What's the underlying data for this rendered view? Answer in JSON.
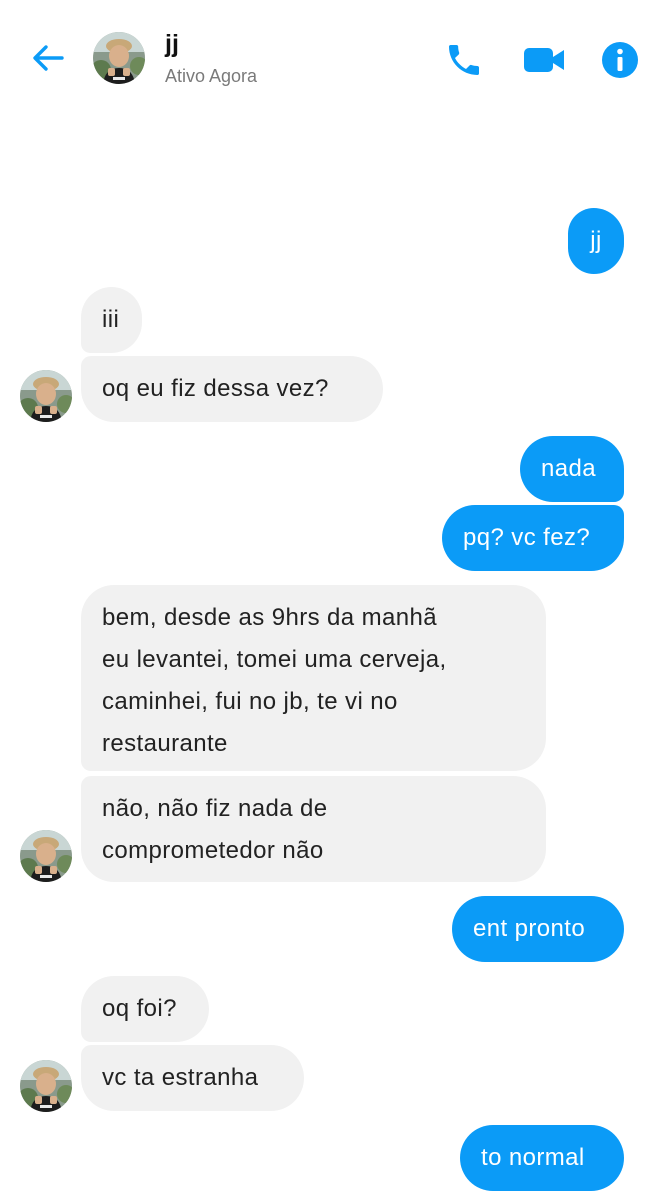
{
  "header": {
    "name": "jj",
    "status": "Ativo Agora",
    "colors": {
      "accent": "#0b9bf7"
    },
    "icons": [
      "back-arrow-icon",
      "phone-icon",
      "video-camera-icon",
      "info-icon"
    ]
  },
  "messages": [
    {
      "side": "out",
      "text": "jj"
    },
    {
      "side": "in",
      "text": "iii"
    },
    {
      "side": "in",
      "text": "oq eu fiz dessa vez?"
    },
    {
      "side": "out",
      "text": "nada"
    },
    {
      "side": "out",
      "text": "pq? vc fez?"
    },
    {
      "side": "in",
      "line1": "bem, desde as 9hrs da manhã",
      "line2": "eu levantei, tomei uma cerveja,",
      "line3": "caminhei, fui no jb, te vi no",
      "line4": "restaurante"
    },
    {
      "side": "in",
      "line1": "não, não fiz nada de",
      "line2": "comprometedor não"
    },
    {
      "side": "out",
      "text": "ent pronto"
    },
    {
      "side": "in",
      "text": "oq foi?"
    },
    {
      "side": "in",
      "text": "vc ta estranha"
    },
    {
      "side": "out",
      "text": "to normal"
    }
  ]
}
